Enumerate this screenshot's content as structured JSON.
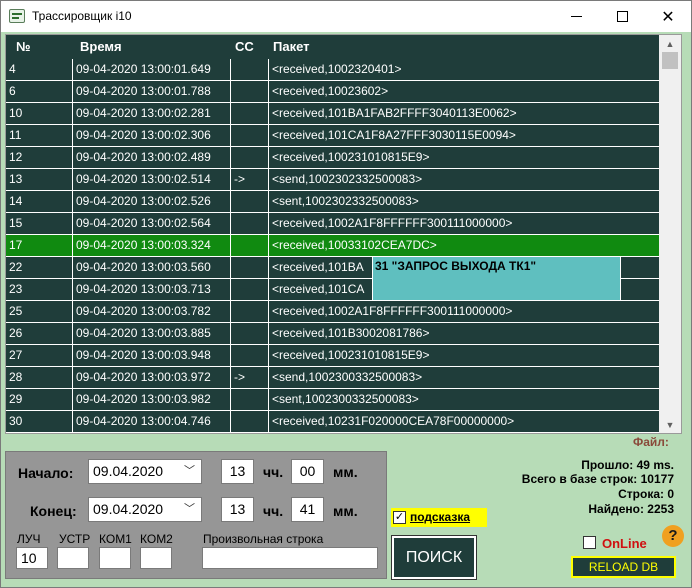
{
  "window": {
    "title": "Трассировщик i10"
  },
  "grid": {
    "columns": [
      "№",
      "Время",
      "CC",
      "Пакет"
    ],
    "rows": [
      {
        "num": "4",
        "time": "09-04-2020 13:00:01.649",
        "cc": "",
        "packet": "<received,1002320401>"
      },
      {
        "num": "6",
        "time": "09-04-2020 13:00:01.788",
        "cc": "",
        "packet": "<received,10023602>"
      },
      {
        "num": "10",
        "time": "09-04-2020 13:00:02.281",
        "cc": "",
        "packet": "<received,101BA1FAB2FFFF3040113E0062>"
      },
      {
        "num": "11",
        "time": "09-04-2020 13:00:02.306",
        "cc": "",
        "packet": "<received,101CA1F8A27FFF3030115E0094>"
      },
      {
        "num": "12",
        "time": "09-04-2020 13:00:02.489",
        "cc": "",
        "packet": "<received,100231010815E9>"
      },
      {
        "num": "13",
        "time": "09-04-2020 13:00:02.514",
        "cc": "->",
        "packet": "<send,1002302332500083>"
      },
      {
        "num": "14",
        "time": "09-04-2020 13:00:02.526",
        "cc": "",
        "packet": "<sent,1002302332500083>"
      },
      {
        "num": "15",
        "time": "09-04-2020 13:00:02.564",
        "cc": "",
        "packet": "<received,1002A1F8FFFFFF300111000000>"
      },
      {
        "num": "17",
        "time": "09-04-2020 13:00:03.324",
        "cc": "",
        "packet": "<received,10033102CEA7DC>",
        "selected": true
      },
      {
        "num": "22",
        "time": "09-04-2020 13:00:03.560",
        "cc": "",
        "packet": "<received,101BA"
      },
      {
        "num": "23",
        "time": "09-04-2020 13:00:03.713",
        "cc": "",
        "packet": "<received,101CA"
      },
      {
        "num": "25",
        "time": "09-04-2020 13:00:03.782",
        "cc": "",
        "packet": "<received,1002A1F8FFFFFF300111000000>"
      },
      {
        "num": "26",
        "time": "09-04-2020 13:00:03.885",
        "cc": "",
        "packet": "<received,101B3002081786>"
      },
      {
        "num": "27",
        "time": "09-04-2020 13:00:03.948",
        "cc": "",
        "packet": "<received,100231010815E9>"
      },
      {
        "num": "28",
        "time": "09-04-2020 13:00:03.972",
        "cc": "->",
        "packet": "<send,1002300332500083>"
      },
      {
        "num": "29",
        "time": "09-04-2020 13:00:03.982",
        "cc": "",
        "packet": "<sent,1002300332500083>"
      },
      {
        "num": "30",
        "time": "09-04-2020 13:00:04.746",
        "cc": "",
        "packet": "<received,10231F020000CEA78F00000000>"
      }
    ],
    "tooltip": "31 \"ЗАПРОС ВЫХОДА ТК1\""
  },
  "filters": {
    "start_label": "Начало:",
    "start_date": "09.04.2020",
    "start_hour": "13",
    "start_min": "00",
    "end_label": "Конец:",
    "end_date": "09.04.2020",
    "end_hour": "13",
    "end_min": "41",
    "hour_unit": "чч.",
    "min_unit": "мм.",
    "luch_label": "ЛУЧ",
    "luch_value": "10",
    "ustr_label": "УСТР",
    "ustr_value": "",
    "kom1_label": "КОМ1",
    "kom1_value": "",
    "kom2_label": "КОМ2",
    "kom2_value": "",
    "free_label": "Произвольная строка",
    "free_value": ""
  },
  "hint": {
    "label": "подсказка",
    "checked": "✓"
  },
  "search_button": "ПОИСК",
  "stats": {
    "file_label": "Файл:",
    "elapsed": "Прошло: 49 ms.",
    "total": "Всего в базе строк: 10177",
    "row": "Строка: 0",
    "found": "Найдено: 2253"
  },
  "online_label": "OnLine",
  "help_label": "?",
  "reload_button": "RELOAD  DB"
}
